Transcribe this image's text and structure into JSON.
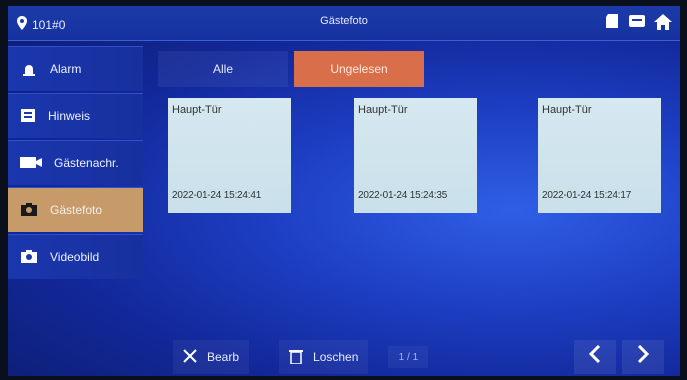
{
  "header": {
    "room_label": "101#0",
    "title": "Gästefoto"
  },
  "sidebar": {
    "items": [
      {
        "label": "Alarm",
        "icon": "alarm-icon"
      },
      {
        "label": "Hinweis",
        "icon": "notice-icon"
      },
      {
        "label": "Gästenachr.",
        "icon": "video-message-icon"
      },
      {
        "label": "Gästefoto",
        "icon": "camera-icon",
        "active": true
      },
      {
        "label": "Videobild",
        "icon": "video-camera-icon"
      }
    ]
  },
  "tabs": [
    {
      "label": "Alle",
      "active": false
    },
    {
      "label": "Ungelesen",
      "active": true
    }
  ],
  "photos": [
    {
      "door": "Haupt-Tür",
      "timestamp": "2022-01-24 15:24:41"
    },
    {
      "door": "Haupt-Tür",
      "timestamp": "2022-01-24 15:24:35"
    },
    {
      "door": "Haupt-Tür",
      "timestamp": "2022-01-24 15:24:17"
    }
  ],
  "toolbar": {
    "edit_label": "Bearb",
    "delete_label": "Loschen",
    "page_indicator": "1 / 1"
  },
  "colors": {
    "active_sidebar": "#c79a6a",
    "active_tab": "#d96e4a",
    "background": "#1d3ec2"
  }
}
